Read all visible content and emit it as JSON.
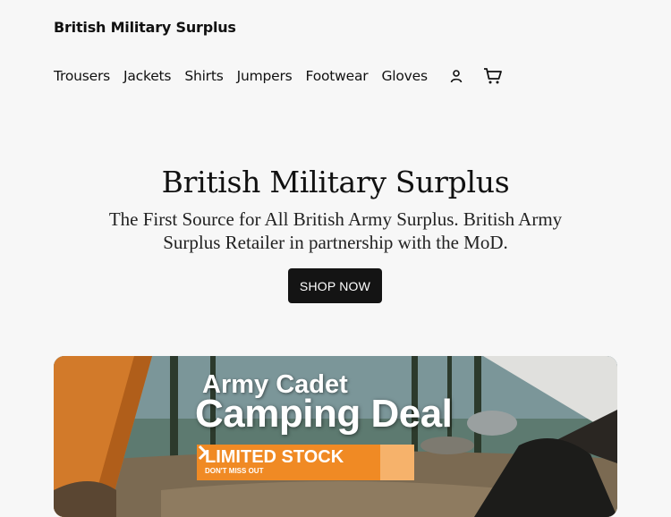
{
  "header": {
    "site_title": "British Military Surplus",
    "nav": [
      "Trousers",
      "Jackets",
      "Shirts",
      "Jumpers",
      "Footwear",
      "Gloves"
    ],
    "icons": [
      "account-icon",
      "cart-icon"
    ]
  },
  "hero": {
    "title": "British Military Surplus",
    "subtitle": "The First Source for All British Army Surplus. British Army Surplus Retailer in partnership with the MoD.",
    "cta": "SHOP NOW"
  },
  "banner": {
    "line1": "Army Cadet",
    "line2": "Camping Deal",
    "badge_main": "LIMITED STOCK",
    "badge_sub": "DON'T MISS OUT",
    "accent_color": "#f08a24"
  }
}
